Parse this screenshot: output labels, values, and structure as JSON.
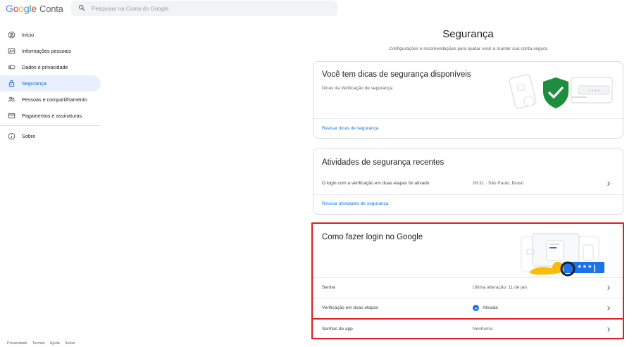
{
  "header": {
    "logo_g": [
      "G",
      "o",
      "o",
      "g",
      "l",
      "e"
    ],
    "logo_conta": "Conta",
    "search_placeholder": "Pesquisar na Conta do Google"
  },
  "sidebar": {
    "items": [
      {
        "label": "Início",
        "icon": "home-icon"
      },
      {
        "label": "Informações pessoais",
        "icon": "id-card-icon"
      },
      {
        "label": "Dados e privacidade",
        "icon": "toggle-icon"
      },
      {
        "label": "Segurança",
        "icon": "lock-icon",
        "active": true
      },
      {
        "label": "Pessoas e compartilhamento",
        "icon": "people-icon"
      },
      {
        "label": "Pagamentos e assinaturas",
        "icon": "credit-card-icon"
      }
    ],
    "about": {
      "label": "Sobre",
      "icon": "info-icon"
    }
  },
  "footer": {
    "links": [
      "Privacidade",
      "Termos",
      "Ajuda",
      "Sobre"
    ]
  },
  "main": {
    "title": "Segurança",
    "subtitle": "Configurações e recomendações para ajudar você a manter sua conta segura",
    "tips_card": {
      "title": "Você tem dicas de segurança disponíveis",
      "subtitle": "Dicas da Verificação de segurança",
      "link": "Revisar dicas de segurança"
    },
    "activity_card": {
      "title": "Atividades de segurança recentes",
      "row_label": "O login com a verificação em duas etapas foi ativado",
      "row_value": "09:31 · São Paulo, Brasil",
      "link": "Revisar atividades de segurança"
    },
    "login_card": {
      "title": "Como fazer login no Google",
      "rows": [
        {
          "label": "Senha",
          "value": "Última alteração: 11 de jan."
        },
        {
          "label": "Verificação em duas etapas",
          "value": "Ativada",
          "status": "checked"
        },
        {
          "label": "Senhas de app",
          "value": "Nenhuma"
        }
      ]
    }
  },
  "colors": {
    "accent": "#1a73e8",
    "active_nav_bg": "#e8f0fe",
    "shield_green": "#1e8e3e",
    "highlight_red": "#e02020"
  }
}
